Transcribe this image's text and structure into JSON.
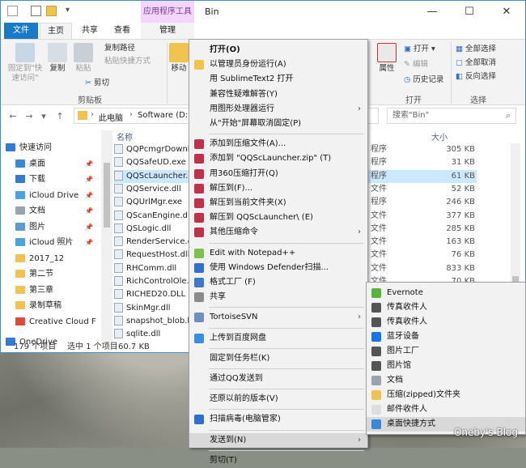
{
  "window": {
    "title": "Bin",
    "context_tab_header": "应用程序工具",
    "controls": [
      "—",
      "☐",
      "✕"
    ]
  },
  "ribbon_tabs": [
    "文件",
    "主页",
    "共享",
    "查看",
    "管理"
  ],
  "ribbon": {
    "pin_quick_access": "固定到\"快\n速访问\"",
    "copy": "复制",
    "paste": "粘贴",
    "copy_path": "复制路径",
    "paste_shortcut": "粘贴快捷方式",
    "cut": "剪切",
    "clipboard_label": "剪贴板",
    "move": "移动",
    "properties": "属性",
    "open": "打开",
    "edit": "编辑",
    "history": "历史记录",
    "open_group_label": "打开",
    "select_all": "全部选择",
    "select_none": "全部取消",
    "invert_selection": "反向选择",
    "select_group_label": "选择"
  },
  "address": {
    "path": [
      "此电脑",
      "Software (D:)"
    ],
    "search_placeholder": "搜索\"Bin\""
  },
  "nav_pane": [
    {
      "label": "快速访问",
      "color": "#2f7bd6",
      "pin": false
    },
    {
      "label": "桌面",
      "color": "#3a88d8",
      "pin": true
    },
    {
      "label": "下载",
      "color": "#2f7bd6",
      "pin": true
    },
    {
      "label": "iCloud Drive",
      "color": "#4aa3e0",
      "pin": true
    },
    {
      "label": "文档",
      "color": "#9aa4ad",
      "pin": true
    },
    {
      "label": "图片",
      "color": "#5b9bd5",
      "pin": true
    },
    {
      "label": "iCloud 照片",
      "color": "#4aa3e0",
      "pin": true
    },
    {
      "label": "2017_12",
      "color": "#f2c24f",
      "pin": false
    },
    {
      "label": "第二节",
      "color": "#f2c24f",
      "pin": false
    },
    {
      "label": "第三章",
      "color": "#f2c24f",
      "pin": false
    },
    {
      "label": "录制草稿",
      "color": "#f2c24f",
      "pin": false
    },
    {
      "label": "Creative Cloud F",
      "color": "#e0493a",
      "pin": false
    },
    {
      "label": "OneDrive",
      "color": "#2f7bd6",
      "pin": false
    }
  ],
  "file_list": {
    "col_name": "名称",
    "col_size": "大小",
    "rows": [
      {
        "name": "QQPcmgrDownl",
        "type": "程序",
        "size": "305 KB",
        "sel": false
      },
      {
        "name": "QQSafeUD.exe",
        "type": "程序",
        "size": "31 KB",
        "sel": false
      },
      {
        "name": "QQScLauncher.e",
        "type": "程序",
        "size": "61 KB",
        "sel": true
      },
      {
        "name": "QQService.dll",
        "type": "文件",
        "size": "52 KB",
        "sel": false
      },
      {
        "name": "QQUrlMgr.exe",
        "type": "程序",
        "size": "246 KB",
        "sel": false
      },
      {
        "name": "QScanEngine.dll",
        "type": "文件",
        "size": "377 KB",
        "sel": false
      },
      {
        "name": "QSLogic.dll",
        "type": "文件",
        "size": "285 KB",
        "sel": false
      },
      {
        "name": "RenderService.d",
        "type": "文件",
        "size": "163 KB",
        "sel": false
      },
      {
        "name": "RequestHost.dll",
        "type": "文件",
        "size": "76 KB",
        "sel": false
      },
      {
        "name": "RHComm.dll",
        "type": "文件",
        "size": "833 KB",
        "sel": false
      },
      {
        "name": "RichControlOle.c",
        "type": "文件",
        "size": "70 KB",
        "sel": false
      },
      {
        "name": "RICHED20.DLL",
        "type": "",
        "size": "",
        "sel": false
      },
      {
        "name": "SkinMgr.dll",
        "type": "",
        "size": "",
        "sel": false
      },
      {
        "name": "snapshot_blob.b",
        "type": "",
        "size": "",
        "sel": false
      },
      {
        "name": "sqlite.dll",
        "type": "",
        "size": "",
        "sel": false
      }
    ]
  },
  "status": {
    "count": "179 个项目",
    "selected": "选中 1 个项目",
    "size": "60.7 KB"
  },
  "context_menu": [
    {
      "label": "打开(O)",
      "bold": true,
      "icon": null,
      "arrow": false
    },
    {
      "label": "以管理员身份运行(A)",
      "icon": "#f2c24f",
      "arrow": false
    },
    {
      "label": "用 SublimeText2 打开",
      "icon": null,
      "arrow": false
    },
    {
      "label": "兼容性疑难解答(Y)",
      "icon": null,
      "arrow": false
    },
    {
      "label": "用图形处理器运行",
      "icon": null,
      "arrow": true
    },
    {
      "label": "从\"开始\"屏幕取消固定(P)",
      "icon": null,
      "arrow": false
    },
    {
      "sep": true
    },
    {
      "label": "添加到压缩文件(A)...",
      "icon": "#c2314a",
      "arrow": false
    },
    {
      "label": "添加到 \"QQScLauncher.zip\" (T)",
      "icon": "#c2314a",
      "arrow": false
    },
    {
      "label": "用360压缩打开(Q)",
      "icon": "#c2314a",
      "arrow": false
    },
    {
      "label": "解压到(F)...",
      "icon": "#c2314a",
      "arrow": false
    },
    {
      "label": "解压到当前文件夹(X)",
      "icon": "#c2314a",
      "arrow": false
    },
    {
      "label": "解压到 QQScLauncher\\ (E)",
      "icon": "#c2314a",
      "arrow": false
    },
    {
      "label": "其他压缩命令",
      "icon": "#c2314a",
      "arrow": true
    },
    {
      "sep": true
    },
    {
      "label": "Edit with Notepad++",
      "icon": "#7fbf4d",
      "arrow": false
    },
    {
      "label": "使用 Windows Defender扫描...",
      "icon": "#2f6fcf",
      "arrow": false
    },
    {
      "label": "格式工厂 (F)",
      "icon": "#3c79c9",
      "arrow": false
    },
    {
      "label": "共享",
      "icon": "#8a8a8a",
      "arrow": false
    },
    {
      "sep": true
    },
    {
      "label": "TortoiseSVN",
      "icon": "#6e8fbf",
      "arrow": true
    },
    {
      "sep": true
    },
    {
      "label": "上传到百度网盘",
      "icon": "#3b8fe2",
      "arrow": false
    },
    {
      "sep": true
    },
    {
      "label": "固定到任务栏(K)",
      "icon": null,
      "arrow": false
    },
    {
      "sep": true
    },
    {
      "label": "通过QQ发送到",
      "icon": null,
      "arrow": false
    },
    {
      "sep": true
    },
    {
      "label": "还原以前的版本(V)",
      "icon": null,
      "arrow": false
    },
    {
      "sep": true
    },
    {
      "label": "扫描病毒(电脑管家)",
      "icon": "#2f6fcf",
      "arrow": false
    },
    {
      "sep": true
    },
    {
      "label": "发送到(N)",
      "icon": null,
      "arrow": true,
      "hot": true
    },
    {
      "sep": true
    },
    {
      "label": "剪切(T)",
      "icon": null,
      "arrow": false
    }
  ],
  "send_to_menu": [
    {
      "label": "Evernote",
      "icon": "#58b33a"
    },
    {
      "label": "传真收件人",
      "icon": "#555555"
    },
    {
      "label": "传真收件人",
      "icon": "#555555"
    },
    {
      "label": "蓝牙设备",
      "icon": "#1b73e8"
    },
    {
      "label": "图片工厂",
      "icon": "#555555"
    },
    {
      "label": "图片馆",
      "icon": "#555555"
    },
    {
      "label": "文档",
      "icon": "#9aa4ad"
    },
    {
      "label": "压缩(zipped)文件夹",
      "icon": "#f2c24f"
    },
    {
      "label": "邮件收件人",
      "icon": "#dddddd"
    },
    {
      "label": "桌面快捷方式",
      "icon": "#3a88d8",
      "hot": true
    }
  ],
  "watermark": "Oneby's Blog"
}
